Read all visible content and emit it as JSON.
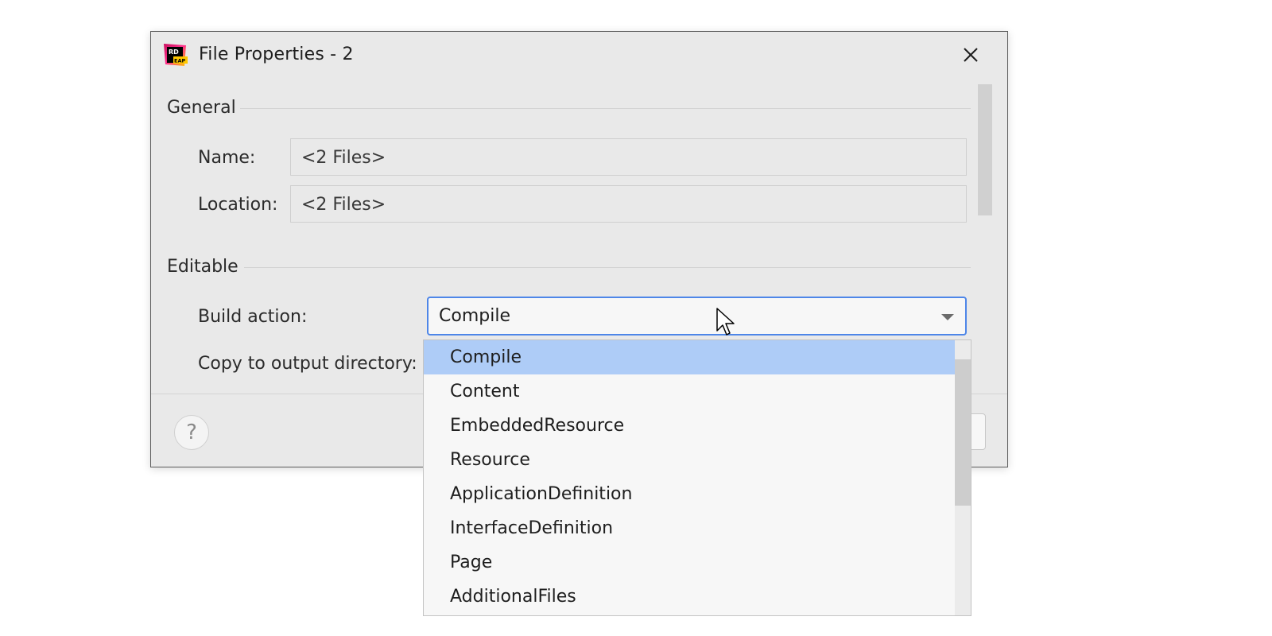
{
  "window": {
    "title": "File Properties - 2",
    "icon": "rider-eap-icon",
    "icon_text_top": "RD",
    "icon_text_bottom": "EAP",
    "close_icon": "close-icon"
  },
  "general": {
    "section_title": "General",
    "name_label": "Name:",
    "name_value": "<2 Files>",
    "location_label": "Location:",
    "location_value": "<2 Files>"
  },
  "editable": {
    "section_title": "Editable",
    "build_action_label": "Build action:",
    "build_action_value": "Compile",
    "copy_label": "Copy to output directory:"
  },
  "footer": {
    "help_label": "?"
  },
  "dropdown": {
    "selected_index": 0,
    "options": [
      "Compile",
      "Content",
      "EmbeddedResource",
      "Resource",
      "ApplicationDefinition",
      "InterfaceDefinition",
      "Page",
      "AdditionalFiles"
    ]
  },
  "colors": {
    "dialog_bg": "#e9e9e9",
    "focus_border": "#4e86e8",
    "selection_bg": "#aeccf7",
    "popup_bg": "#f7f7f7"
  }
}
